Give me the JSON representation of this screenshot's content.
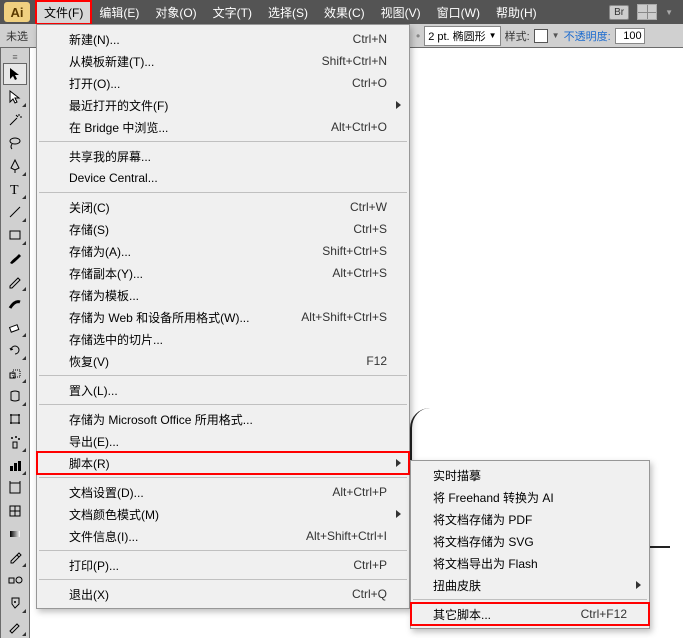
{
  "app": {
    "icon_text": "Ai",
    "br": "Br"
  },
  "menubar": {
    "file": "文件(F)",
    "edit": "编辑(E)",
    "object": "对象(O)",
    "text": "文字(T)",
    "select": "选择(S)",
    "effect": "效果(C)",
    "view": "视图(V)",
    "window": "窗口(W)",
    "help": "帮助(H)"
  },
  "optionbar": {
    "left_text": "未选",
    "stroke_val": "2 pt. 椭圆形",
    "style_lbl": "样式:",
    "opacity_lbl": "不透明度:",
    "opacity_val": "100"
  },
  "file_menu": [
    {
      "type": "item",
      "label": "新建(N)...",
      "shortcut": "Ctrl+N"
    },
    {
      "type": "item",
      "label": "从模板新建(T)...",
      "shortcut": "Shift+Ctrl+N"
    },
    {
      "type": "item",
      "label": "打开(O)...",
      "shortcut": "Ctrl+O"
    },
    {
      "type": "item",
      "label": "最近打开的文件(F)",
      "submenu": true
    },
    {
      "type": "item",
      "label": "在 Bridge 中浏览...",
      "shortcut": "Alt+Ctrl+O"
    },
    {
      "type": "sep"
    },
    {
      "type": "item",
      "label": "共享我的屏幕..."
    },
    {
      "type": "item",
      "label": "Device Central..."
    },
    {
      "type": "sep"
    },
    {
      "type": "item",
      "label": "关闭(C)",
      "shortcut": "Ctrl+W"
    },
    {
      "type": "item",
      "label": "存储(S)",
      "shortcut": "Ctrl+S"
    },
    {
      "type": "item",
      "label": "存储为(A)...",
      "shortcut": "Shift+Ctrl+S"
    },
    {
      "type": "item",
      "label": "存储副本(Y)...",
      "shortcut": "Alt+Ctrl+S"
    },
    {
      "type": "item",
      "label": "存储为模板..."
    },
    {
      "type": "item",
      "label": "存储为 Web 和设备所用格式(W)...",
      "shortcut": "Alt+Shift+Ctrl+S"
    },
    {
      "type": "item",
      "label": "存储选中的切片..."
    },
    {
      "type": "item",
      "label": "恢复(V)",
      "shortcut": "F12"
    },
    {
      "type": "sep"
    },
    {
      "type": "item",
      "label": "置入(L)..."
    },
    {
      "type": "sep"
    },
    {
      "type": "item",
      "label": "存储为 Microsoft Office 所用格式..."
    },
    {
      "type": "item",
      "label": "导出(E)..."
    },
    {
      "type": "item",
      "label": "脚本(R)",
      "submenu": true,
      "highlight": true
    },
    {
      "type": "sep"
    },
    {
      "type": "item",
      "label": "文档设置(D)...",
      "shortcut": "Alt+Ctrl+P"
    },
    {
      "type": "item",
      "label": "文档颜色模式(M)",
      "submenu": true
    },
    {
      "type": "item",
      "label": "文件信息(I)...",
      "shortcut": "Alt+Shift+Ctrl+I"
    },
    {
      "type": "sep"
    },
    {
      "type": "item",
      "label": "打印(P)...",
      "shortcut": "Ctrl+P"
    },
    {
      "type": "sep"
    },
    {
      "type": "item",
      "label": "退出(X)",
      "shortcut": "Ctrl+Q"
    }
  ],
  "script_submenu": [
    {
      "type": "item",
      "label": "实时描摹"
    },
    {
      "type": "item",
      "label": "将 Freehand 转换为 AI"
    },
    {
      "type": "item",
      "label": "将文档存储为 PDF"
    },
    {
      "type": "item",
      "label": "将文档存储为 SVG"
    },
    {
      "type": "item",
      "label": "将文档导出为 Flash"
    },
    {
      "type": "item",
      "label": "扭曲皮肤",
      "submenu": true
    },
    {
      "type": "sep"
    },
    {
      "type": "item",
      "label": "其它脚本...",
      "shortcut": "Ctrl+F12",
      "highlight": true
    }
  ]
}
